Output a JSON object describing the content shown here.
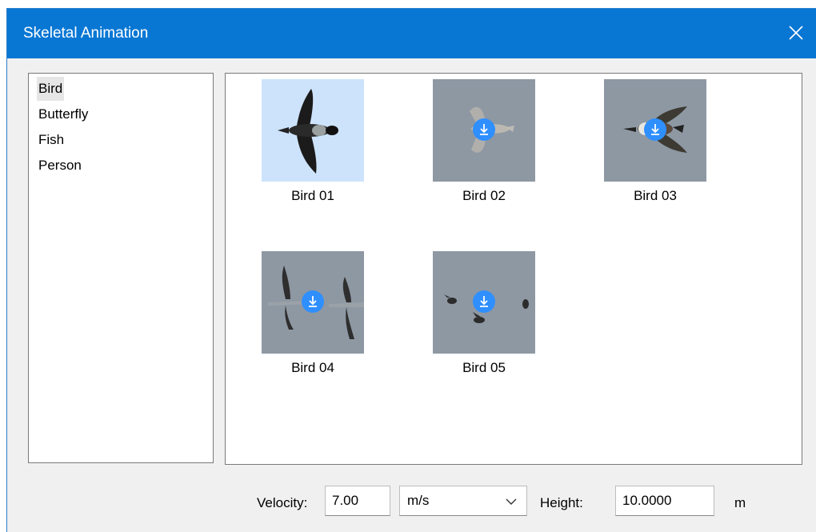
{
  "window": {
    "title": "Skeletal Animation"
  },
  "categories": [
    {
      "label": "Bird",
      "selected": true
    },
    {
      "label": "Butterfly"
    },
    {
      "label": "Fish"
    },
    {
      "label": "Person"
    }
  ],
  "gallery": [
    {
      "label": "Bird 01",
      "selected": true,
      "downloaded": true
    },
    {
      "label": "Bird 02",
      "downloaded": false
    },
    {
      "label": "Bird 03",
      "downloaded": false
    },
    {
      "label": "Bird 04",
      "downloaded": false
    },
    {
      "label": "Bird 05",
      "downloaded": false
    }
  ],
  "footer": {
    "velocity_label": "Velocity:",
    "velocity_value": "7.00",
    "velocity_unit": "m/s",
    "height_label": "Height:",
    "height_value": "10.0000",
    "height_unit": "m"
  },
  "colors": {
    "titlebar": "#0877d4",
    "download_badge": "#2f8fff",
    "selected_thumb": "#cde3fb"
  }
}
